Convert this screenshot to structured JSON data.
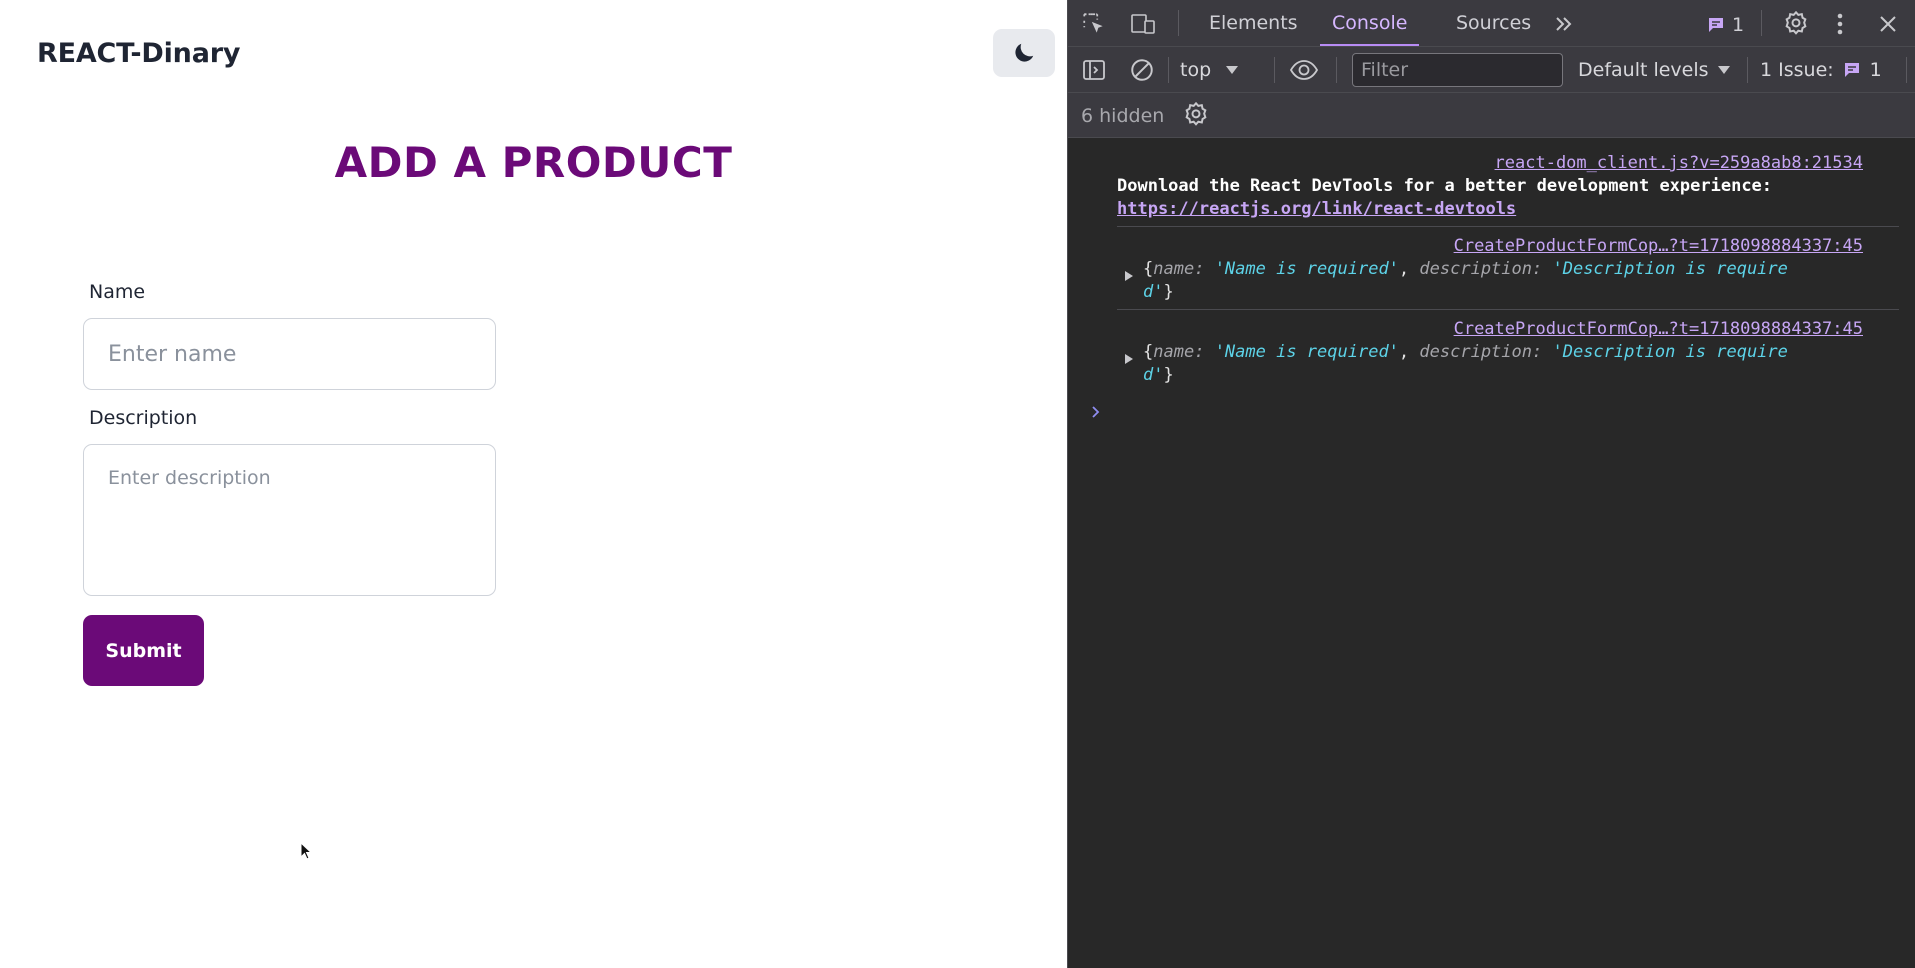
{
  "app": {
    "brand": "REACT-Dinary",
    "page_title": "ADD A PRODUCT",
    "form": {
      "name_label": "Name",
      "name_placeholder": "Enter name",
      "name_value": "",
      "description_label": "Description",
      "description_placeholder": "Enter description",
      "description_value": "",
      "submit_label": "Submit"
    },
    "theme_toggle_icon": "moon-icon",
    "colors": {
      "accent": "#6b0a78",
      "text": "#1f2533",
      "toggle_bg": "#e8eaee"
    }
  },
  "devtools": {
    "tabs": [
      {
        "label": "Elements",
        "active": false
      },
      {
        "label": "Console",
        "active": true
      },
      {
        "label": "Sources",
        "active": false
      }
    ],
    "more_tabs_icon": "chevron-double-right-icon",
    "issues_badge_count": "1",
    "toolbar": {
      "context": "top",
      "filter_placeholder": "Filter",
      "filter_value": "",
      "levels": "Default levels",
      "issues_label": "1 Issue:",
      "issues_count": "1"
    },
    "hidden_label": "6 hidden",
    "messages": [
      {
        "source": "react-dom_client.js?v=259a8ab8:21534",
        "text": "Download the React DevTools for a better development experience:",
        "link": "https://reactjs.org/link/react-devtools"
      },
      {
        "source": "CreateProductFormCop…?t=1718098884337:45",
        "key1": "name",
        "val1": "'Name is required'",
        "key2": "description",
        "val2_line1": "'Description is require",
        "val2_line2": "d'"
      },
      {
        "source": "CreateProductFormCop…?t=1718098884337:45",
        "key1": "name",
        "val1": "'Name is required'",
        "key2": "description",
        "val2_line1": "'Description is require",
        "val2_line2": "d'"
      }
    ],
    "colors": {
      "bg": "#282828",
      "toolbar": "#3b3a40",
      "accent": "#d6b7ff",
      "string": "#5dd3e8"
    }
  }
}
